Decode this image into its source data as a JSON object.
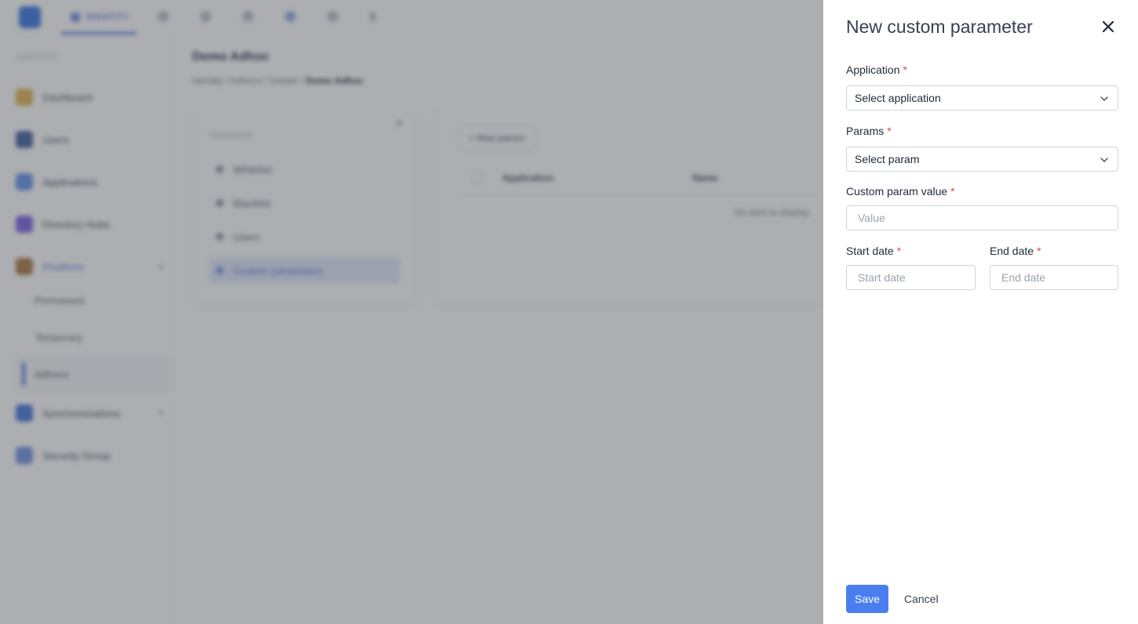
{
  "background": {
    "topbar": {
      "app_tab": "IDENTITY"
    },
    "sidebar": {
      "caption": "IDENTITY",
      "items": [
        {
          "label": "Dashboard",
          "icon": "dashboard-icon"
        },
        {
          "label": "Users",
          "icon": "user-icon"
        },
        {
          "label": "Applications",
          "icon": "applications-icon"
        },
        {
          "label": "Directory Hubs",
          "icon": "hub-icon"
        },
        {
          "label": "Positions",
          "icon": "briefcase-icon"
        },
        {
          "label": "Synchronizations",
          "icon": "sync-icon"
        },
        {
          "label": "Security Group",
          "icon": "shield-icon"
        }
      ],
      "sub_items": [
        "Permanent",
        "Temporary",
        "Adhocs"
      ]
    },
    "main": {
      "title": "Demo Adhoc",
      "breadcrumb": [
        "Identity",
        "Adhocs",
        "Details",
        "Demo Adhoc"
      ],
      "panel": {
        "title": "OVERVIEW",
        "items": [
          "Whitelist",
          "Blacklist",
          "Users",
          "Custom parameters"
        ]
      },
      "table": {
        "new_button": "+ New param",
        "columns": [
          "Application",
          "Name"
        ],
        "empty_text": "No item to display"
      }
    }
  },
  "drawer": {
    "title": "New custom parameter",
    "fields": {
      "application": {
        "label": "Application",
        "placeholder": "Select application"
      },
      "params": {
        "label": "Params",
        "placeholder": "Select param"
      },
      "custom_value": {
        "label": "Custom param value",
        "placeholder": "Value"
      },
      "start_date": {
        "label": "Start date",
        "placeholder": "Start date"
      },
      "end_date": {
        "label": "End date",
        "placeholder": "End date"
      }
    },
    "required_mark": "*",
    "save_label": "Save",
    "cancel_label": "Cancel"
  },
  "colors": {
    "accent": "#4a7ef0",
    "required": "#e5484d",
    "overlay": "rgba(75,78,85,0.46)"
  }
}
